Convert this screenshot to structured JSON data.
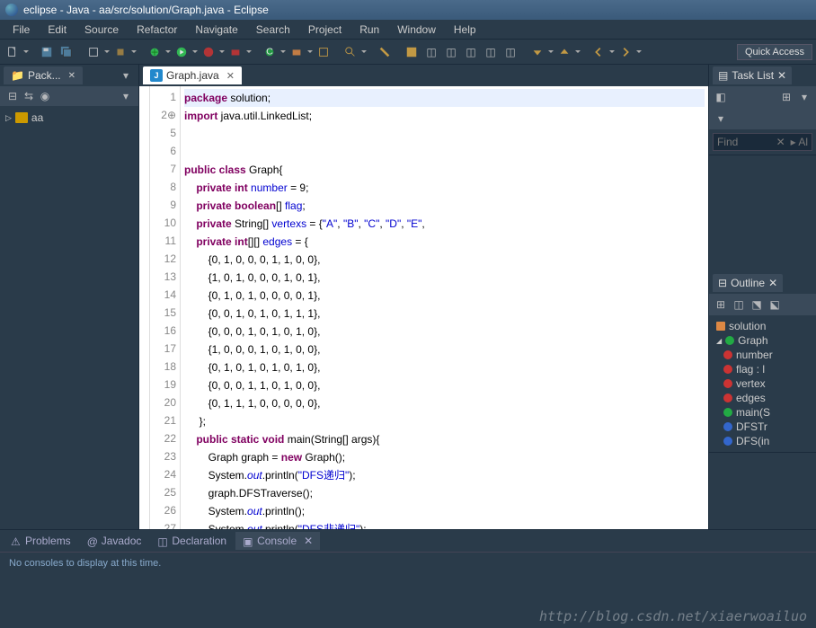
{
  "window": {
    "title": "eclipse - Java - aa/src/solution/Graph.java - Eclipse"
  },
  "menu": [
    "File",
    "Edit",
    "Source",
    "Refactor",
    "Navigate",
    "Search",
    "Project",
    "Run",
    "Window",
    "Help"
  ],
  "quick_access": "Quick Access",
  "left": {
    "tab": "Pack...",
    "project": "aa"
  },
  "editor": {
    "tab": "Graph.java",
    "lines": [
      {
        "n": 1,
        "tokens": [
          {
            "t": "package",
            "c": "kw"
          },
          {
            "t": " solution;",
            "c": ""
          }
        ]
      },
      {
        "n": 2,
        "tokens": [
          {
            "t": "import",
            "c": "kw"
          },
          {
            "t": " java.util.LinkedList;",
            "c": ""
          }
        ],
        "fold": true
      },
      {
        "n": 5,
        "tokens": []
      },
      {
        "n": 6,
        "tokens": []
      },
      {
        "n": 7,
        "tokens": [
          {
            "t": "public class",
            "c": "kw"
          },
          {
            "t": " Graph{",
            "c": ""
          }
        ]
      },
      {
        "n": 8,
        "tokens": [
          {
            "t": "    ",
            "c": ""
          },
          {
            "t": "private int",
            "c": "kw"
          },
          {
            "t": " ",
            "c": ""
          },
          {
            "t": "number",
            "c": "fld"
          },
          {
            "t": " = 9;",
            "c": ""
          }
        ]
      },
      {
        "n": 9,
        "tokens": [
          {
            "t": "    ",
            "c": ""
          },
          {
            "t": "private boolean",
            "c": "kw"
          },
          {
            "t": "[] ",
            "c": ""
          },
          {
            "t": "flag",
            "c": "fld"
          },
          {
            "t": ";",
            "c": ""
          }
        ]
      },
      {
        "n": 10,
        "tokens": [
          {
            "t": "    ",
            "c": ""
          },
          {
            "t": "private",
            "c": "kw"
          },
          {
            "t": " String[] ",
            "c": ""
          },
          {
            "t": "vertexs",
            "c": "fld"
          },
          {
            "t": " = {",
            "c": ""
          },
          {
            "t": "\"A\"",
            "c": "str"
          },
          {
            "t": ", ",
            "c": ""
          },
          {
            "t": "\"B\"",
            "c": "str"
          },
          {
            "t": ", ",
            "c": ""
          },
          {
            "t": "\"C\"",
            "c": "str"
          },
          {
            "t": ", ",
            "c": ""
          },
          {
            "t": "\"D\"",
            "c": "str"
          },
          {
            "t": ", ",
            "c": ""
          },
          {
            "t": "\"E\"",
            "c": "str"
          },
          {
            "t": ",",
            "c": ""
          }
        ]
      },
      {
        "n": 11,
        "tokens": [
          {
            "t": "    ",
            "c": ""
          },
          {
            "t": "private int",
            "c": "kw"
          },
          {
            "t": "[][] ",
            "c": ""
          },
          {
            "t": "edges",
            "c": "fld"
          },
          {
            "t": " = {",
            "c": ""
          }
        ]
      },
      {
        "n": 12,
        "tokens": [
          {
            "t": "        {0, 1, 0, 0, 0, 1, 1, 0, 0},",
            "c": ""
          }
        ]
      },
      {
        "n": 13,
        "tokens": [
          {
            "t": "        {1, 0, 1, 0, 0, 0, 1, 0, 1},",
            "c": ""
          }
        ]
      },
      {
        "n": 14,
        "tokens": [
          {
            "t": "        {0, 1, 0, 1, 0, 0, 0, 0, 1},",
            "c": ""
          }
        ]
      },
      {
        "n": 15,
        "tokens": [
          {
            "t": "        {0, 0, 1, 0, 1, 0, 1, 1, 1},",
            "c": ""
          }
        ]
      },
      {
        "n": 16,
        "tokens": [
          {
            "t": "        {0, 0, 0, 1, 0, 1, 0, 1, 0},",
            "c": ""
          }
        ]
      },
      {
        "n": 17,
        "tokens": [
          {
            "t": "        {1, 0, 0, 0, 1, 0, 1, 0, 0},",
            "c": ""
          }
        ]
      },
      {
        "n": 18,
        "tokens": [
          {
            "t": "        {0, 1, 0, 1, 0, 1, 0, 1, 0},",
            "c": ""
          }
        ]
      },
      {
        "n": 19,
        "tokens": [
          {
            "t": "        {0, 0, 0, 1, 1, 0, 1, 0, 0},",
            "c": ""
          }
        ]
      },
      {
        "n": 20,
        "tokens": [
          {
            "t": "        {0, 1, 1, 1, 0, 0, 0, 0, 0},",
            "c": ""
          }
        ]
      },
      {
        "n": 21,
        "tokens": [
          {
            "t": "     };",
            "c": ""
          }
        ]
      },
      {
        "n": 22,
        "tokens": [
          {
            "t": "    ",
            "c": ""
          },
          {
            "t": "public static void",
            "c": "kw"
          },
          {
            "t": " main(String[] args){",
            "c": ""
          }
        ]
      },
      {
        "n": 23,
        "tokens": [
          {
            "t": "        Graph ",
            "c": ""
          },
          {
            "t": "graph",
            "c": ""
          },
          {
            "t": " = ",
            "c": ""
          },
          {
            "t": "new",
            "c": "kw"
          },
          {
            "t": " Graph();",
            "c": ""
          }
        ]
      },
      {
        "n": 24,
        "tokens": [
          {
            "t": "        System.",
            "c": ""
          },
          {
            "t": "out",
            "c": "sti"
          },
          {
            "t": ".println(",
            "c": ""
          },
          {
            "t": "\"DFS递归\"",
            "c": "str"
          },
          {
            "t": ");",
            "c": ""
          }
        ]
      },
      {
        "n": 25,
        "tokens": [
          {
            "t": "        ",
            "c": ""
          },
          {
            "t": "graph",
            "c": ""
          },
          {
            "t": ".DFSTraverse();",
            "c": ""
          }
        ]
      },
      {
        "n": 26,
        "tokens": [
          {
            "t": "        System.",
            "c": ""
          },
          {
            "t": "out",
            "c": "sti"
          },
          {
            "t": ".println();",
            "c": ""
          }
        ]
      },
      {
        "n": 27,
        "tokens": [
          {
            "t": "        System.",
            "c": ""
          },
          {
            "t": "out",
            "c": "sti"
          },
          {
            "t": ".println(",
            "c": ""
          },
          {
            "t": "\"DFS非递归\"",
            "c": "str"
          },
          {
            "t": ");",
            "c": ""
          }
        ]
      }
    ]
  },
  "tasklist": {
    "title": "Task List",
    "find": "Find"
  },
  "outline": {
    "title": "Outline",
    "items": [
      {
        "icon": "pkg",
        "label": "solution",
        "lvl": 0
      },
      {
        "icon": "cls",
        "label": "Graph",
        "lvl": 0,
        "exp": true
      },
      {
        "icon": "fld",
        "label": "number",
        "lvl": 1
      },
      {
        "icon": "fld",
        "label": "flag : l",
        "lvl": 1
      },
      {
        "icon": "fld",
        "label": "vertex",
        "lvl": 1
      },
      {
        "icon": "fld",
        "label": "edges",
        "lvl": 1
      },
      {
        "icon": "mth",
        "label": "main(S",
        "lvl": 1
      },
      {
        "icon": "mthb",
        "label": "DFSTr",
        "lvl": 1
      },
      {
        "icon": "mthb",
        "label": "DFS(in",
        "lvl": 1
      }
    ]
  },
  "bottom": {
    "tabs": [
      "Problems",
      "Javadoc",
      "Declaration",
      "Console"
    ],
    "active": 3,
    "message": "No consoles to display at this time."
  },
  "watermark": "http://blog.csdn.net/xiaerwoailuo"
}
